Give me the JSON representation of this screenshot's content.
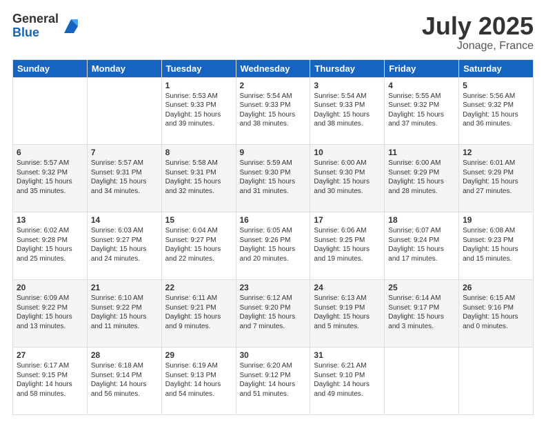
{
  "logo": {
    "general": "General",
    "blue": "Blue"
  },
  "title": "July 2025",
  "location": "Jonage, France",
  "days_header": [
    "Sunday",
    "Monday",
    "Tuesday",
    "Wednesday",
    "Thursday",
    "Friday",
    "Saturday"
  ],
  "weeks": [
    [
      {
        "day": "",
        "sunrise": "",
        "sunset": "",
        "daylight": ""
      },
      {
        "day": "",
        "sunrise": "",
        "sunset": "",
        "daylight": ""
      },
      {
        "day": "1",
        "sunrise": "Sunrise: 5:53 AM",
        "sunset": "Sunset: 9:33 PM",
        "daylight": "Daylight: 15 hours and 39 minutes."
      },
      {
        "day": "2",
        "sunrise": "Sunrise: 5:54 AM",
        "sunset": "Sunset: 9:33 PM",
        "daylight": "Daylight: 15 hours and 38 minutes."
      },
      {
        "day": "3",
        "sunrise": "Sunrise: 5:54 AM",
        "sunset": "Sunset: 9:33 PM",
        "daylight": "Daylight: 15 hours and 38 minutes."
      },
      {
        "day": "4",
        "sunrise": "Sunrise: 5:55 AM",
        "sunset": "Sunset: 9:32 PM",
        "daylight": "Daylight: 15 hours and 37 minutes."
      },
      {
        "day": "5",
        "sunrise": "Sunrise: 5:56 AM",
        "sunset": "Sunset: 9:32 PM",
        "daylight": "Daylight: 15 hours and 36 minutes."
      }
    ],
    [
      {
        "day": "6",
        "sunrise": "Sunrise: 5:57 AM",
        "sunset": "Sunset: 9:32 PM",
        "daylight": "Daylight: 15 hours and 35 minutes."
      },
      {
        "day": "7",
        "sunrise": "Sunrise: 5:57 AM",
        "sunset": "Sunset: 9:31 PM",
        "daylight": "Daylight: 15 hours and 34 minutes."
      },
      {
        "day": "8",
        "sunrise": "Sunrise: 5:58 AM",
        "sunset": "Sunset: 9:31 PM",
        "daylight": "Daylight: 15 hours and 32 minutes."
      },
      {
        "day": "9",
        "sunrise": "Sunrise: 5:59 AM",
        "sunset": "Sunset: 9:30 PM",
        "daylight": "Daylight: 15 hours and 31 minutes."
      },
      {
        "day": "10",
        "sunrise": "Sunrise: 6:00 AM",
        "sunset": "Sunset: 9:30 PM",
        "daylight": "Daylight: 15 hours and 30 minutes."
      },
      {
        "day": "11",
        "sunrise": "Sunrise: 6:00 AM",
        "sunset": "Sunset: 9:29 PM",
        "daylight": "Daylight: 15 hours and 28 minutes."
      },
      {
        "day": "12",
        "sunrise": "Sunrise: 6:01 AM",
        "sunset": "Sunset: 9:29 PM",
        "daylight": "Daylight: 15 hours and 27 minutes."
      }
    ],
    [
      {
        "day": "13",
        "sunrise": "Sunrise: 6:02 AM",
        "sunset": "Sunset: 9:28 PM",
        "daylight": "Daylight: 15 hours and 25 minutes."
      },
      {
        "day": "14",
        "sunrise": "Sunrise: 6:03 AM",
        "sunset": "Sunset: 9:27 PM",
        "daylight": "Daylight: 15 hours and 24 minutes."
      },
      {
        "day": "15",
        "sunrise": "Sunrise: 6:04 AM",
        "sunset": "Sunset: 9:27 PM",
        "daylight": "Daylight: 15 hours and 22 minutes."
      },
      {
        "day": "16",
        "sunrise": "Sunrise: 6:05 AM",
        "sunset": "Sunset: 9:26 PM",
        "daylight": "Daylight: 15 hours and 20 minutes."
      },
      {
        "day": "17",
        "sunrise": "Sunrise: 6:06 AM",
        "sunset": "Sunset: 9:25 PM",
        "daylight": "Daylight: 15 hours and 19 minutes."
      },
      {
        "day": "18",
        "sunrise": "Sunrise: 6:07 AM",
        "sunset": "Sunset: 9:24 PM",
        "daylight": "Daylight: 15 hours and 17 minutes."
      },
      {
        "day": "19",
        "sunrise": "Sunrise: 6:08 AM",
        "sunset": "Sunset: 9:23 PM",
        "daylight": "Daylight: 15 hours and 15 minutes."
      }
    ],
    [
      {
        "day": "20",
        "sunrise": "Sunrise: 6:09 AM",
        "sunset": "Sunset: 9:22 PM",
        "daylight": "Daylight: 15 hours and 13 minutes."
      },
      {
        "day": "21",
        "sunrise": "Sunrise: 6:10 AM",
        "sunset": "Sunset: 9:22 PM",
        "daylight": "Daylight: 15 hours and 11 minutes."
      },
      {
        "day": "22",
        "sunrise": "Sunrise: 6:11 AM",
        "sunset": "Sunset: 9:21 PM",
        "daylight": "Daylight: 15 hours and 9 minutes."
      },
      {
        "day": "23",
        "sunrise": "Sunrise: 6:12 AM",
        "sunset": "Sunset: 9:20 PM",
        "daylight": "Daylight: 15 hours and 7 minutes."
      },
      {
        "day": "24",
        "sunrise": "Sunrise: 6:13 AM",
        "sunset": "Sunset: 9:19 PM",
        "daylight": "Daylight: 15 hours and 5 minutes."
      },
      {
        "day": "25",
        "sunrise": "Sunrise: 6:14 AM",
        "sunset": "Sunset: 9:17 PM",
        "daylight": "Daylight: 15 hours and 3 minutes."
      },
      {
        "day": "26",
        "sunrise": "Sunrise: 6:15 AM",
        "sunset": "Sunset: 9:16 PM",
        "daylight": "Daylight: 15 hours and 0 minutes."
      }
    ],
    [
      {
        "day": "27",
        "sunrise": "Sunrise: 6:17 AM",
        "sunset": "Sunset: 9:15 PM",
        "daylight": "Daylight: 14 hours and 58 minutes."
      },
      {
        "day": "28",
        "sunrise": "Sunrise: 6:18 AM",
        "sunset": "Sunset: 9:14 PM",
        "daylight": "Daylight: 14 hours and 56 minutes."
      },
      {
        "day": "29",
        "sunrise": "Sunrise: 6:19 AM",
        "sunset": "Sunset: 9:13 PM",
        "daylight": "Daylight: 14 hours and 54 minutes."
      },
      {
        "day": "30",
        "sunrise": "Sunrise: 6:20 AM",
        "sunset": "Sunset: 9:12 PM",
        "daylight": "Daylight: 14 hours and 51 minutes."
      },
      {
        "day": "31",
        "sunrise": "Sunrise: 6:21 AM",
        "sunset": "Sunset: 9:10 PM",
        "daylight": "Daylight: 14 hours and 49 minutes."
      },
      {
        "day": "",
        "sunrise": "",
        "sunset": "",
        "daylight": ""
      },
      {
        "day": "",
        "sunrise": "",
        "sunset": "",
        "daylight": ""
      }
    ]
  ]
}
